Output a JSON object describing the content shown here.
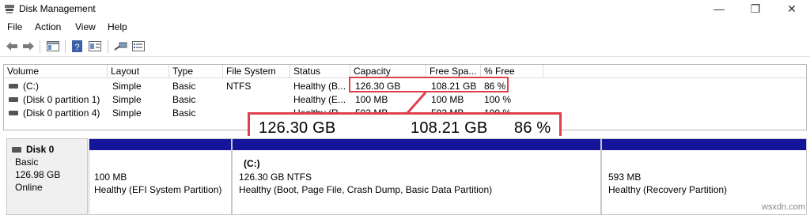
{
  "window": {
    "title": "Disk Management",
    "controls": {
      "minimize": "—",
      "maximize": "❐",
      "close": "✕"
    }
  },
  "menu": {
    "file": "File",
    "action": "Action",
    "view": "View",
    "help": "Help"
  },
  "toolbar": {
    "icons": [
      "back-icon",
      "forward-icon",
      "console-tree-icon",
      "help-icon",
      "properties-icon",
      "connect-icon",
      "list-icon"
    ]
  },
  "volume_list": {
    "columns": [
      "Volume",
      "Layout",
      "Type",
      "File System",
      "Status",
      "Capacity",
      "Free Spa...",
      "% Free"
    ],
    "rows": [
      {
        "volume": "(C:)",
        "layout": "Simple",
        "type": "Basic",
        "fs": "NTFS",
        "status": "Healthy (B...",
        "capacity": "126.30 GB",
        "free": "108.21 GB",
        "pct": "86 %"
      },
      {
        "volume": "(Disk 0 partition 1)",
        "layout": "Simple",
        "type": "Basic",
        "fs": "",
        "status": "Healthy (E...",
        "capacity": "100 MB",
        "free": "100 MB",
        "pct": "100 %"
      },
      {
        "volume": "(Disk 0 partition 4)",
        "layout": "Simple",
        "type": "Basic",
        "fs": "",
        "status": "Healthy (R...",
        "capacity": "593 MB",
        "free": "593 MB",
        "pct": "100 %"
      }
    ]
  },
  "zoom_callout": {
    "capacity": "126.30 GB",
    "free": "108.21 GB",
    "pct": "86 %"
  },
  "disk": {
    "name": "Disk 0",
    "type": "Basic",
    "size": "126.98 GB",
    "status": "Online",
    "partitions": [
      {
        "title": "",
        "size": "100 MB",
        "status": "Healthy (EFI System Partition)"
      },
      {
        "title": "(C:)",
        "size": "126.30 GB NTFS",
        "status": "Healthy (Boot, Page File, Crash Dump, Basic Data Partition)"
      },
      {
        "title": "",
        "size": "593 MB",
        "status": "Healthy (Recovery Partition)"
      }
    ]
  },
  "watermark": "wsxdn.com",
  "colors": {
    "highlight": "#e0404b",
    "partition_bar": "#15159a"
  }
}
